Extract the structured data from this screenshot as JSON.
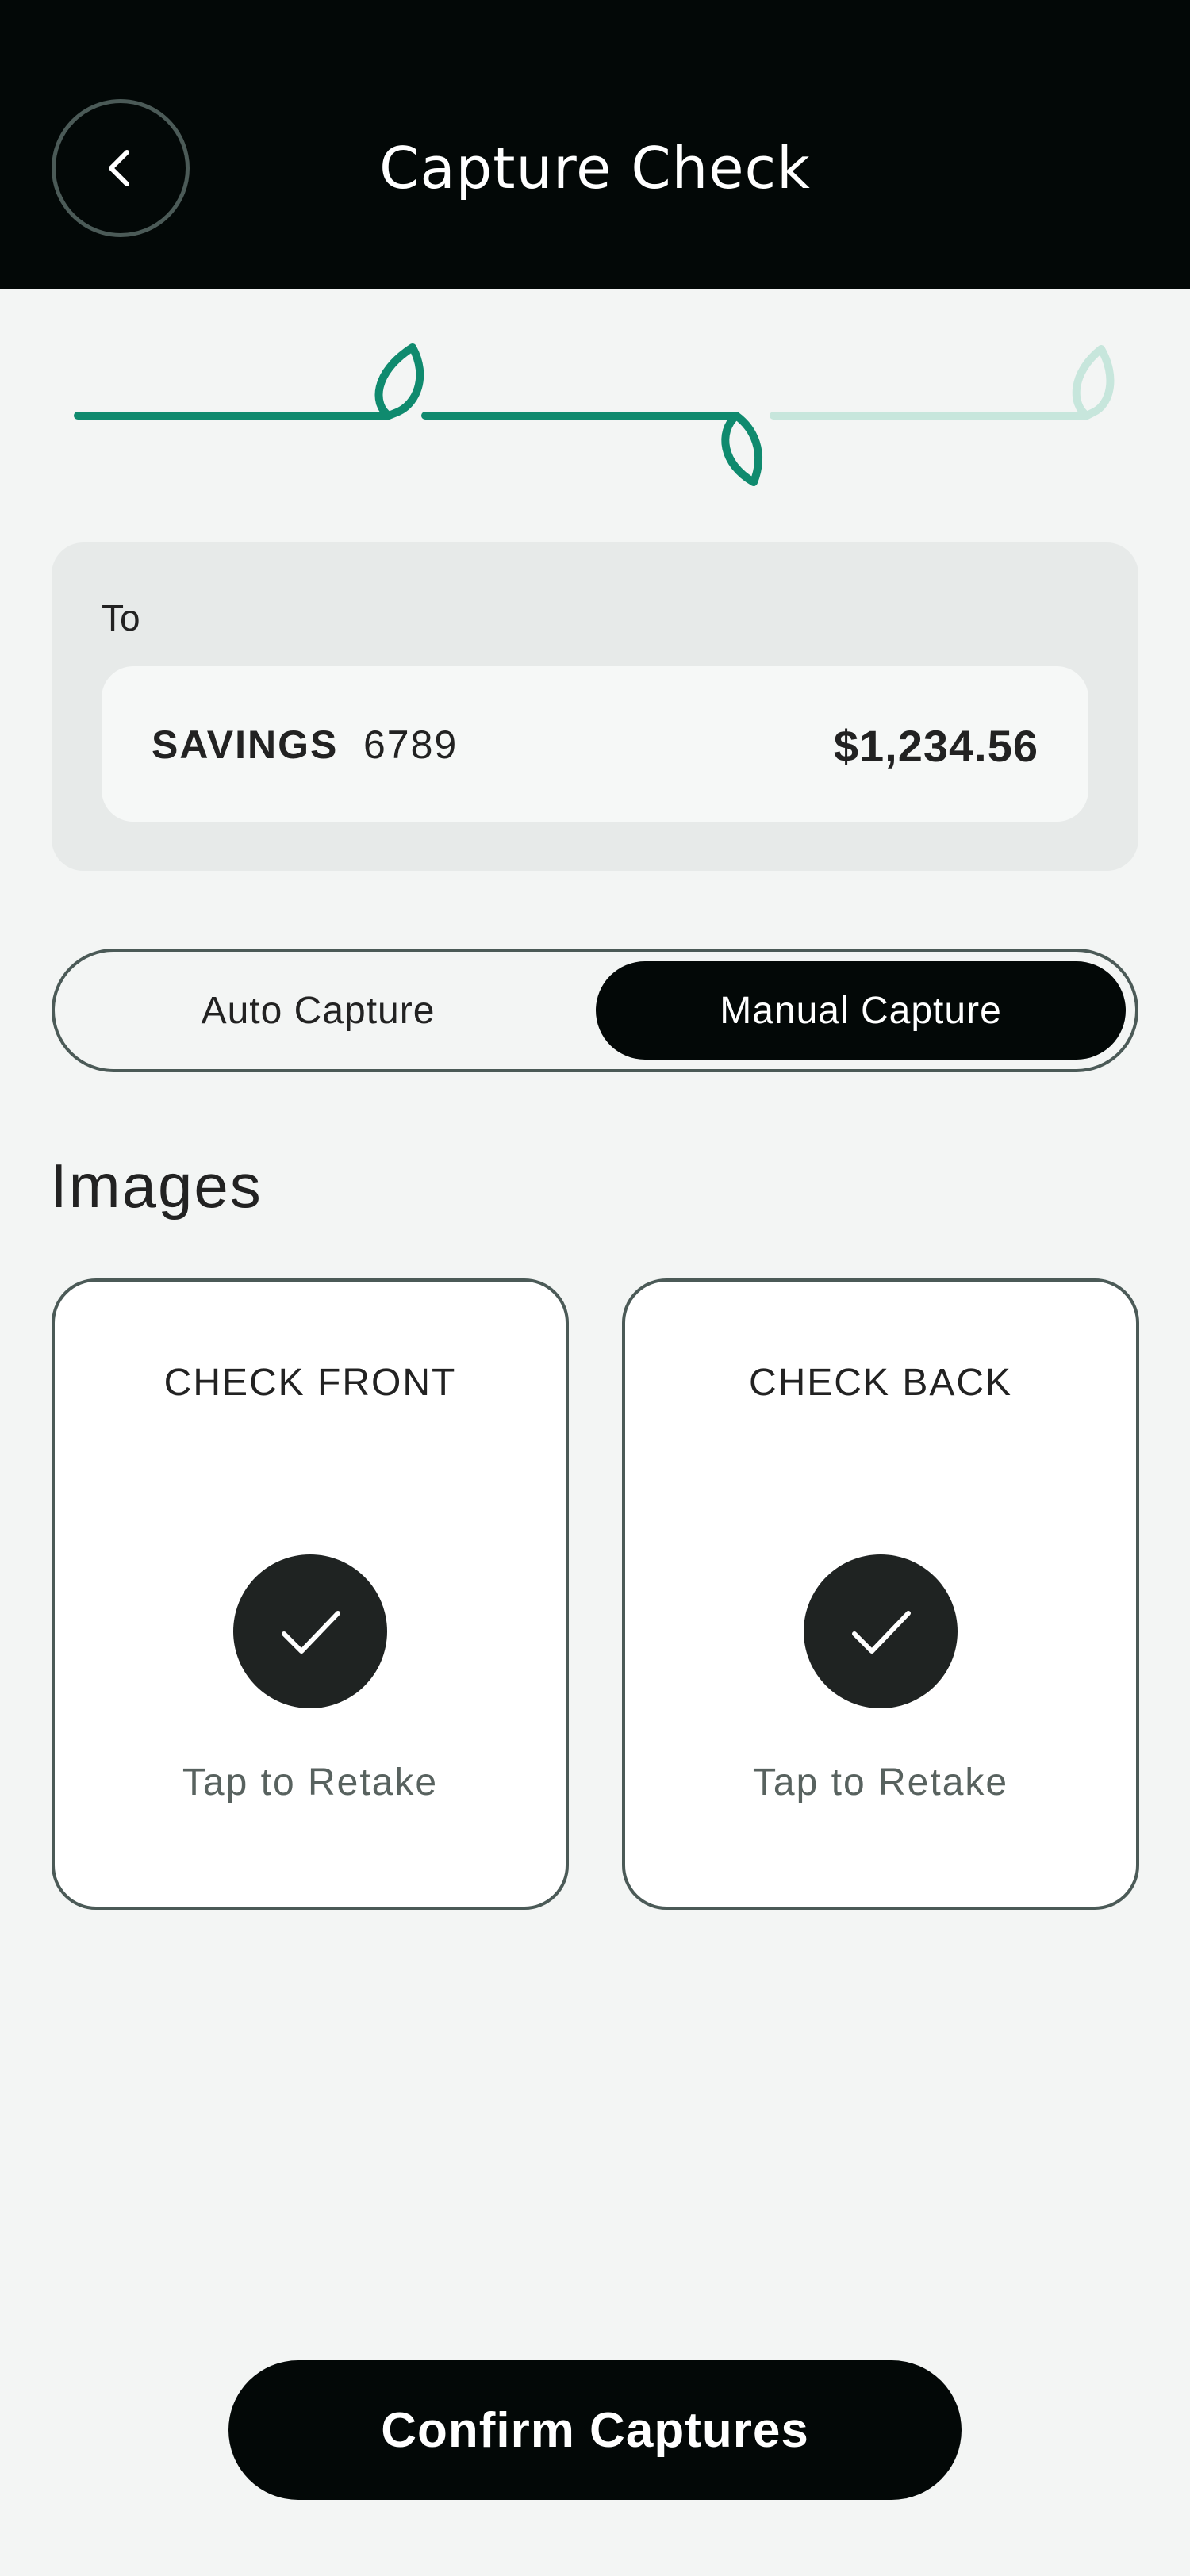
{
  "header": {
    "title": "Capture Check",
    "back_icon": "chevron-left-icon"
  },
  "stepper": {
    "total_steps": 3,
    "completed_steps": 2,
    "colors": {
      "active": "#0f8a6e",
      "inactive": "#c7e6dc"
    }
  },
  "to_section": {
    "label": "To",
    "account": {
      "name": "SAVINGS",
      "number": "6789",
      "balance": "$1,234.56"
    }
  },
  "capture_mode": {
    "options": [
      "Auto Capture",
      "Manual Capture"
    ],
    "selected": "Manual Capture"
  },
  "images": {
    "heading": "Images",
    "cards": [
      {
        "title": "CHECK FRONT",
        "status_icon": "checkmark-icon",
        "action": "Tap to Retake"
      },
      {
        "title": "CHECK BACK",
        "status_icon": "checkmark-icon",
        "action": "Tap to Retake"
      }
    ]
  },
  "footer": {
    "confirm_label": "Confirm Captures"
  },
  "colors": {
    "header_bg": "#030807",
    "page_bg": "#f3f5f4",
    "accent": "#0f8a6e"
  }
}
